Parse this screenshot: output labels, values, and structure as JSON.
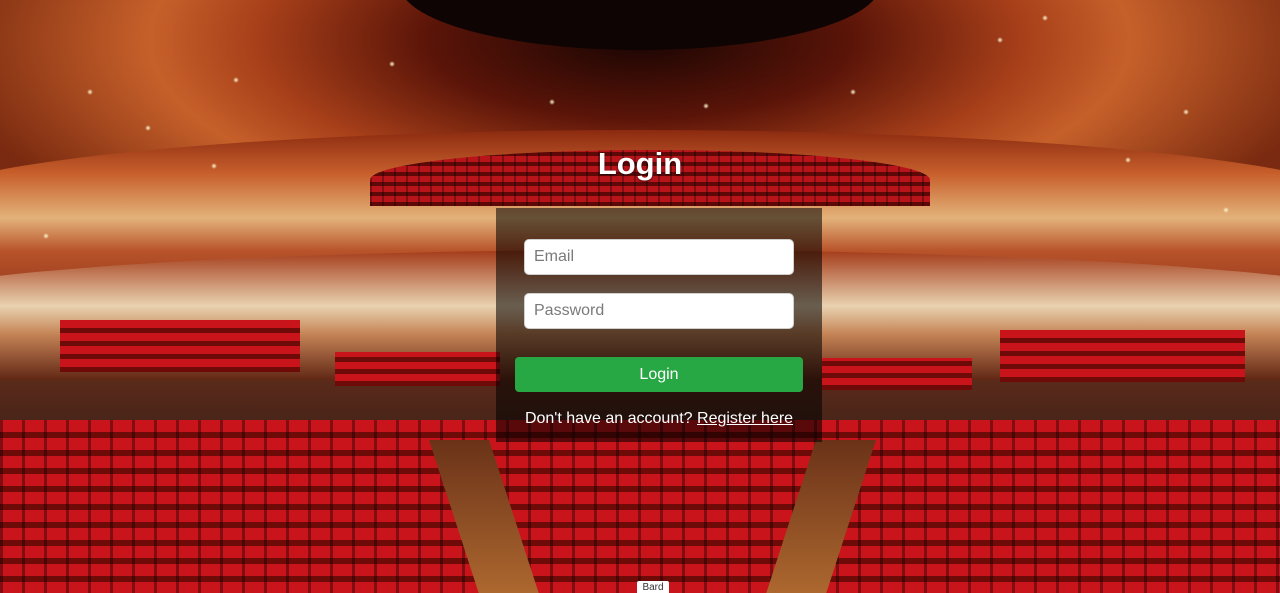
{
  "login": {
    "title": "Login",
    "email_placeholder": "Email",
    "password_placeholder": "Password",
    "submit_label": "Login",
    "register_prompt": "Don't have an account?",
    "register_link": "Register here"
  },
  "footer": {
    "badge": "Bard"
  }
}
